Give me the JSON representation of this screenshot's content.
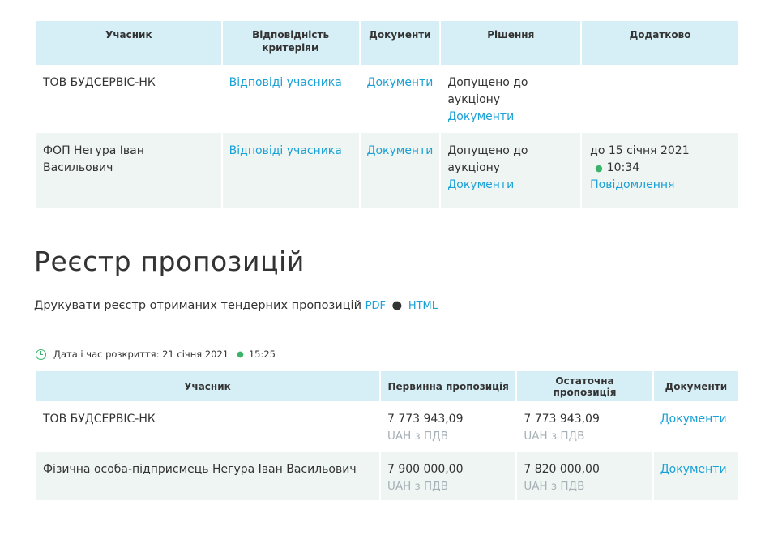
{
  "qualification_table": {
    "headers": {
      "participant": "Учасник",
      "criteria": "Відповідність критеріям",
      "documents": "Документи",
      "decision": "Рішення",
      "additional": "Додатково"
    },
    "rows": [
      {
        "participant": "ТОВ БУДСЕРВІС-НК",
        "criteria_link": "Відповіді учасника",
        "documents_link": "Документи",
        "decision_text": "Допущено до аукціону",
        "decision_docs_link": "Документи",
        "additional": null
      },
      {
        "participant": "ФОП Негура Іван Васильович",
        "criteria_link": "Відповіді учасника",
        "documents_link": "Документи",
        "decision_text": "Допущено до аукціону",
        "decision_docs_link": "Документи",
        "additional": {
          "deadline_date": "до 15 січня 2021",
          "deadline_time": "10:34",
          "message_link": "Повідомлення"
        }
      }
    ]
  },
  "registry": {
    "title": "Реєстр пропозицій",
    "print_text": "Друкувати реєстр отриманих тендерних пропозицій",
    "print_pdf": "PDF",
    "print_separator": "●",
    "print_html": "HTML",
    "opening_label": "Дата і час розкриття: 21 січня 2021",
    "opening_time": "15:25"
  },
  "bids_table": {
    "headers": {
      "participant": "Учасник",
      "initial": "Первинна пропозиція",
      "final": "Остаточна пропозиція",
      "documents": "Документи"
    },
    "rows": [
      {
        "participant": "ТОВ БУДСЕРВІС-НК",
        "initial_amount": "7 773 943,09",
        "initial_currency": "UAH з ПДВ",
        "final_amount": "7 773 943,09",
        "final_currency": "UAH з ПДВ",
        "documents_link": "Документи"
      },
      {
        "participant": "Фізична особа-підприємець Негура Іван Васильович",
        "initial_amount": "7 900 000,00",
        "initial_currency": "UAH з ПДВ",
        "final_amount": "7 820 000,00",
        "final_currency": "UAH з ПДВ",
        "documents_link": "Документи"
      }
    ]
  },
  "colors": {
    "link": "#1ba1d6",
    "header_bg": "#d6eef5",
    "alt_row_bg": "#eef5f2",
    "accent_green": "#3bb36b",
    "muted_text": "#a7b0b6"
  }
}
